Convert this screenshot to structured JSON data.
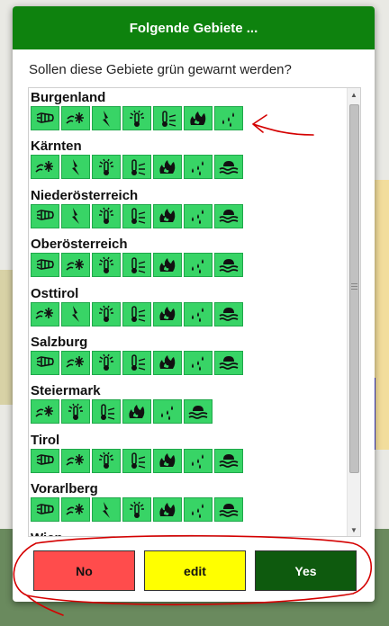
{
  "dialog": {
    "title": "Folgende Gebiete ...",
    "question": "Sollen diese Gebiete grün gewarnt werden?"
  },
  "colors": {
    "header": "#0e820e",
    "warning_icon_green": "#38d466",
    "no_button": "#ff4c4c",
    "edit_button": "#ffff00",
    "yes_button": "#0e5a0e",
    "annotation": "#d40000"
  },
  "regions": [
    {
      "name": "Burgenland",
      "icons": [
        "wind-icon",
        "snow-rain-icon",
        "thunderstorm-icon",
        "heat-icon",
        "cold-icon",
        "forest-fire-icon",
        "rain-icon"
      ]
    },
    {
      "name": "Kärnten",
      "icons": [
        "snow-rain-icon",
        "thunderstorm-icon",
        "heat-icon",
        "cold-icon",
        "forest-fire-icon",
        "rain-icon",
        "flood-icon"
      ]
    },
    {
      "name": "Niederösterreich",
      "icons": [
        "wind-icon",
        "thunderstorm-icon",
        "heat-icon",
        "cold-icon",
        "forest-fire-icon",
        "rain-icon",
        "flood-icon"
      ]
    },
    {
      "name": "Oberösterreich",
      "icons": [
        "wind-icon",
        "snow-rain-icon",
        "heat-icon",
        "cold-icon",
        "forest-fire-icon",
        "rain-icon",
        "flood-icon"
      ]
    },
    {
      "name": "Osttirol",
      "icons": [
        "snow-rain-icon",
        "thunderstorm-icon",
        "heat-icon",
        "cold-icon",
        "forest-fire-icon",
        "rain-icon",
        "flood-icon"
      ]
    },
    {
      "name": "Salzburg",
      "icons": [
        "wind-icon",
        "snow-rain-icon",
        "heat-icon",
        "cold-icon",
        "forest-fire-icon",
        "rain-icon",
        "flood-icon"
      ]
    },
    {
      "name": "Steiermark",
      "icons": [
        "snow-rain-icon",
        "heat-icon",
        "cold-icon",
        "forest-fire-icon",
        "rain-icon",
        "flood-icon"
      ]
    },
    {
      "name": "Tirol",
      "icons": [
        "wind-icon",
        "snow-rain-icon",
        "heat-icon",
        "cold-icon",
        "forest-fire-icon",
        "rain-icon",
        "flood-icon"
      ]
    },
    {
      "name": "Vorarlberg",
      "icons": [
        "wind-icon",
        "snow-rain-icon",
        "thunderstorm-icon",
        "heat-icon",
        "forest-fire-icon",
        "rain-icon",
        "flood-icon"
      ]
    },
    {
      "name": "Wien",
      "icons": []
    }
  ],
  "buttons": {
    "no": "No",
    "edit": "edit",
    "yes": "Yes"
  }
}
